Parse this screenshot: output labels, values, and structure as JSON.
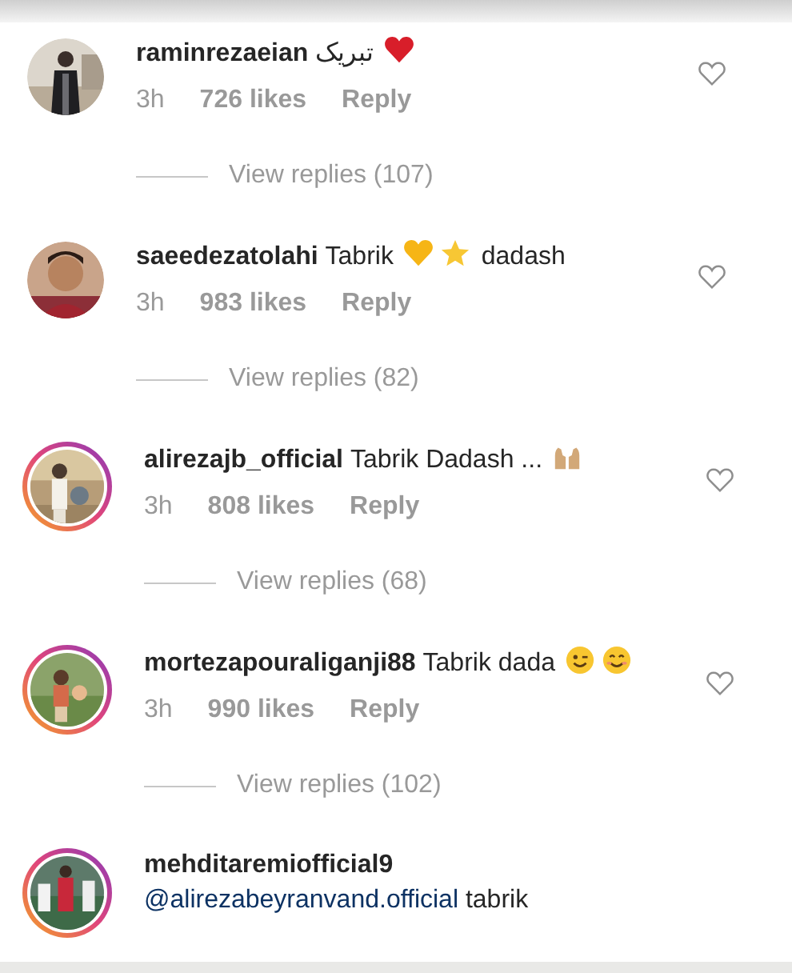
{
  "comments": [
    {
      "username": "raminrezaeian",
      "story_ring": false,
      "body": [
        {
          "kind": "text",
          "text": "تبریک"
        },
        {
          "kind": "red-heart"
        }
      ],
      "time": "3h",
      "likes": "726 likes",
      "reply": "Reply",
      "view_replies": "View replies (107)"
    },
    {
      "username": "saeedezatolahi",
      "story_ring": false,
      "body": [
        {
          "kind": "text",
          "text": "Tabrik"
        },
        {
          "kind": "yellow-heart"
        },
        {
          "kind": "star"
        },
        {
          "kind": "text",
          "text": "dadash"
        }
      ],
      "time": "3h",
      "likes": "983 likes",
      "reply": "Reply",
      "view_replies": "View replies (82)"
    },
    {
      "username": "alirezajb_official",
      "story_ring": true,
      "body": [
        {
          "kind": "text",
          "text": "Tabrik Dadash ..."
        },
        {
          "kind": "raised-hands"
        }
      ],
      "time": "3h",
      "likes": "808 likes",
      "reply": "Reply",
      "view_replies": "View replies (68)"
    },
    {
      "username": "mortezapouraliganji88",
      "story_ring": true,
      "body": [
        {
          "kind": "text",
          "text": "Tabrik dada"
        },
        {
          "kind": "wink"
        },
        {
          "kind": "smile"
        }
      ],
      "time": "3h",
      "likes": "990 likes",
      "reply": "Reply",
      "view_replies": "View replies (102)"
    },
    {
      "username": "mehditaremiofficial9",
      "story_ring": true,
      "body": [
        {
          "kind": "mention",
          "text": "@alirezabeyranvand.official"
        },
        {
          "kind": "text",
          "text": "tabrik"
        }
      ]
    }
  ]
}
